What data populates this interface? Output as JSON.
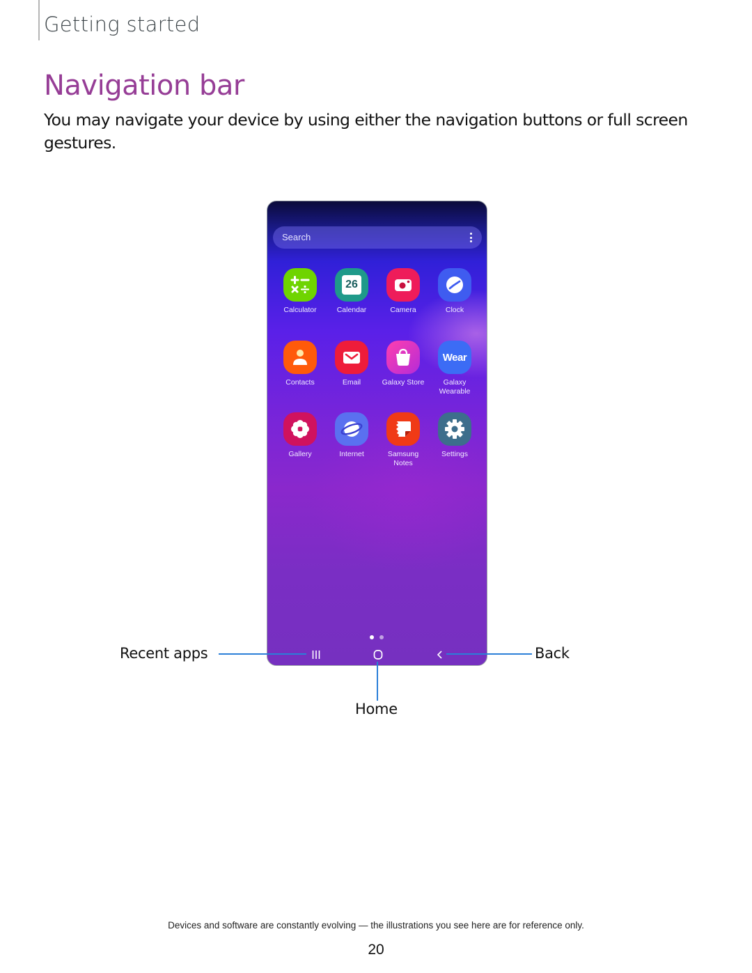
{
  "header": {
    "section": "Getting started"
  },
  "main": {
    "title": "Navigation bar",
    "intro": "You may navigate your device by using either the navigation buttons or full screen gestures."
  },
  "phone": {
    "search": {
      "placeholder": "Search",
      "menu_icon": "more-vertical-icon"
    },
    "apps": [
      {
        "label": "Calculator",
        "icon": "calculator-icon",
        "color": "#6fd400"
      },
      {
        "label": "Calendar",
        "icon": "calendar-icon",
        "color": "#1f9a8a",
        "badge": "26"
      },
      {
        "label": "Camera",
        "icon": "camera-icon",
        "color": "#ee1c5a"
      },
      {
        "label": "Clock",
        "icon": "clock-icon",
        "color": "#3f5cf0"
      },
      {
        "label": "Contacts",
        "icon": "contacts-icon",
        "color": "#ff5a0a"
      },
      {
        "label": "Email",
        "icon": "email-icon",
        "color": "#ee1c3a"
      },
      {
        "label": "Galaxy Store",
        "icon": "shopping-bag-icon",
        "color": "#e52bbb"
      },
      {
        "label": "Galaxy Wearable",
        "icon": "wear-icon",
        "color": "#3c6cf5",
        "badge": "Wear"
      },
      {
        "label": "Gallery",
        "icon": "flower-icon",
        "color": "#d0125e"
      },
      {
        "label": "Internet",
        "icon": "planet-icon",
        "color": "#5a70f0"
      },
      {
        "label": "Samsung Notes",
        "icon": "notes-icon",
        "color": "#f03a16"
      },
      {
        "label": "Settings",
        "icon": "gear-icon",
        "color": "#3d6e8c"
      }
    ],
    "page_indicator": {
      "current": 1,
      "total": 2
    },
    "nav_buttons": [
      "recent-apps-icon",
      "home-icon",
      "back-icon"
    ]
  },
  "callouts": {
    "recent": "Recent apps",
    "home": "Home",
    "back": "Back",
    "line_color": "#2b7fd8"
  },
  "footer": {
    "note": "Devices and software are constantly evolving — the illustrations you see here are for reference only.",
    "page_number": "20"
  }
}
